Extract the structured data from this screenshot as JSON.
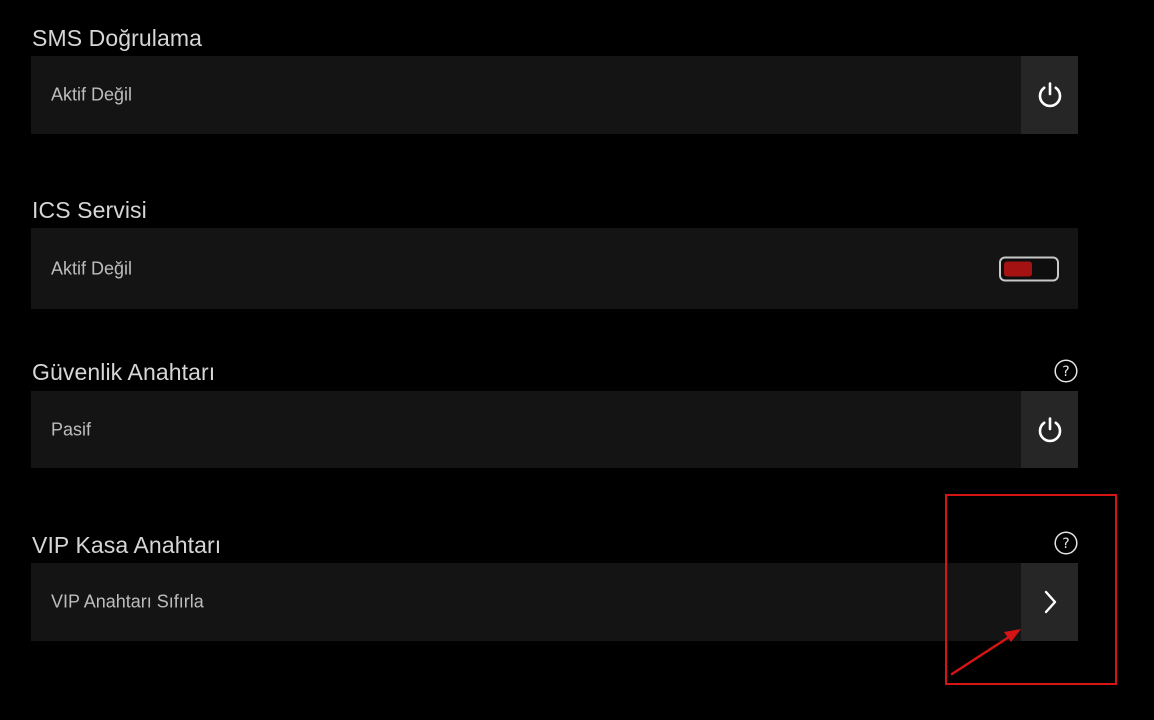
{
  "sections": [
    {
      "title": "SMS Doğrulama",
      "status": "Aktif Değil",
      "control": "power-button"
    },
    {
      "title": "ICS Servisi",
      "status": "Aktif Değil",
      "control": "toggle",
      "toggle_on": false
    },
    {
      "title": "Güvenlik Anahtarı",
      "status": "Pasif",
      "control": "power-button",
      "help": "?"
    },
    {
      "title": "VIP Kasa Anahtarı",
      "status": "VIP Anahtarı Sıfırla",
      "control": "chevron-right-button",
      "help": "?"
    }
  ],
  "icons": {
    "power": "power-icon",
    "chevron": "chevron-right-icon",
    "help": "question-circle-icon"
  },
  "colors": {
    "background": "#000000",
    "row_background": "#141414",
    "button_background": "#262626",
    "toggle_knob_off": "#a51212",
    "annotation_red": "#d71414"
  }
}
